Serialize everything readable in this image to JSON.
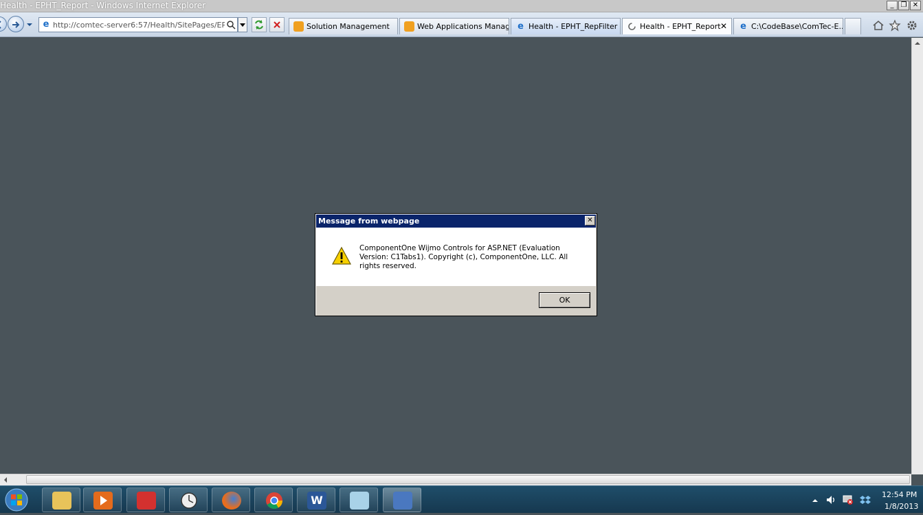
{
  "window": {
    "title": "Health - EPHT_Report - Windows Internet Explorer",
    "minimize_glyph": "_",
    "restore_glyph": "❐",
    "close_glyph": "✕"
  },
  "navbar": {
    "address_url": "http://comtec-server6:57/Health/SitePages/EPHT_I",
    "back_icon": "back-arrow-icon",
    "forward_icon": "forward-arrow-icon"
  },
  "tabs": [
    {
      "label": "Solution Management",
      "icon": "sharepoint-icon"
    },
    {
      "label": "Web Applications Manag...",
      "icon": "sharepoint-icon"
    },
    {
      "label": "Health - EPHT_RepFilter",
      "icon": "ie-icon"
    },
    {
      "label": "Health - EPHT_Report",
      "icon": "loading-icon"
    },
    {
      "label": "C:\\CodeBase\\ComTec-E...",
      "icon": "ie-icon"
    }
  ],
  "tab_close_glyph": "✕",
  "dialog": {
    "title": "Message from webpage",
    "message": "ComponentOne Wijmo Controls for ASP.NET (Evaluation Version: C1Tabs1). Copyright (c), ComponentOne, LLC.  All rights reserved.",
    "ok_label": "OK",
    "close_glyph": "✕"
  },
  "taskbar": {
    "time": "12:54 PM",
    "date": "1/8/2013",
    "word_letter": "W"
  },
  "colors": {
    "content_bg": "#4a545a",
    "dialog_title_bg": "#0a246a",
    "taskbar_bg": "#1f4e6a"
  }
}
